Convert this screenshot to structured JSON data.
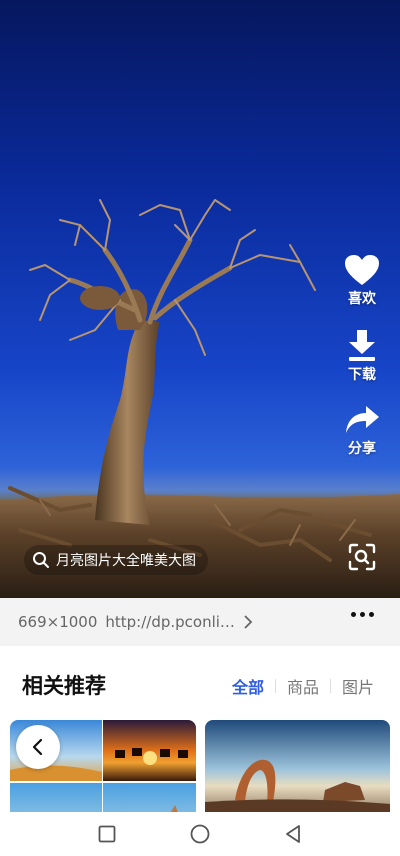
{
  "actions": {
    "like_label": "喜欢",
    "download_label": "下载",
    "share_label": "分享"
  },
  "search": {
    "query": "月亮图片大全唯美大图"
  },
  "image_info": {
    "dimensions": "669×1000",
    "source_url": "http://dp.pconli…"
  },
  "related": {
    "title": "相关推荐",
    "tabs": [
      {
        "label": "全部",
        "active": true
      },
      {
        "label": "商品",
        "active": false
      },
      {
        "label": "图片",
        "active": false
      }
    ]
  },
  "colors": {
    "accent": "#2f5fe0",
    "sky_top": "#06175e",
    "sky_mid": "#1745c8"
  },
  "icons": {
    "like": "heart-icon",
    "download": "download-icon",
    "share": "share-icon",
    "search": "search-icon",
    "scan": "scan-icon",
    "more": "more-icon",
    "back": "back-icon"
  }
}
